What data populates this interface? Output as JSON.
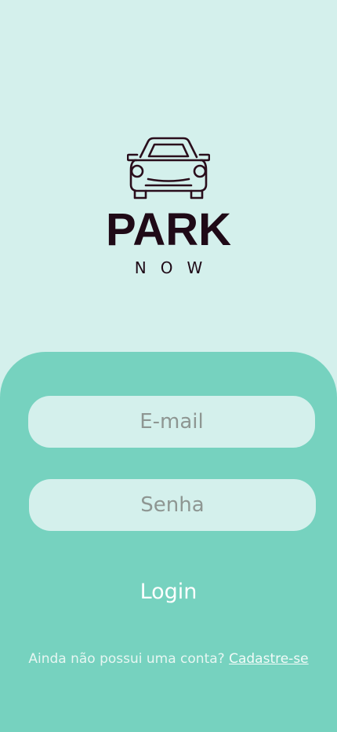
{
  "brand": {
    "logo_icon": "car-icon",
    "title": "PARK",
    "tagline": "NOW",
    "color": "#1f0a17"
  },
  "login_form": {
    "email_placeholder": "E-mail",
    "password_placeholder": "Senha",
    "login_label": "Login"
  },
  "signup": {
    "prompt": "Ainda não possui uma conta?",
    "link_label": "Cadastre-se"
  },
  "colors": {
    "background": "#d4f0ec",
    "panel": "#76d2bf",
    "input_background": "#d4f0ec"
  }
}
